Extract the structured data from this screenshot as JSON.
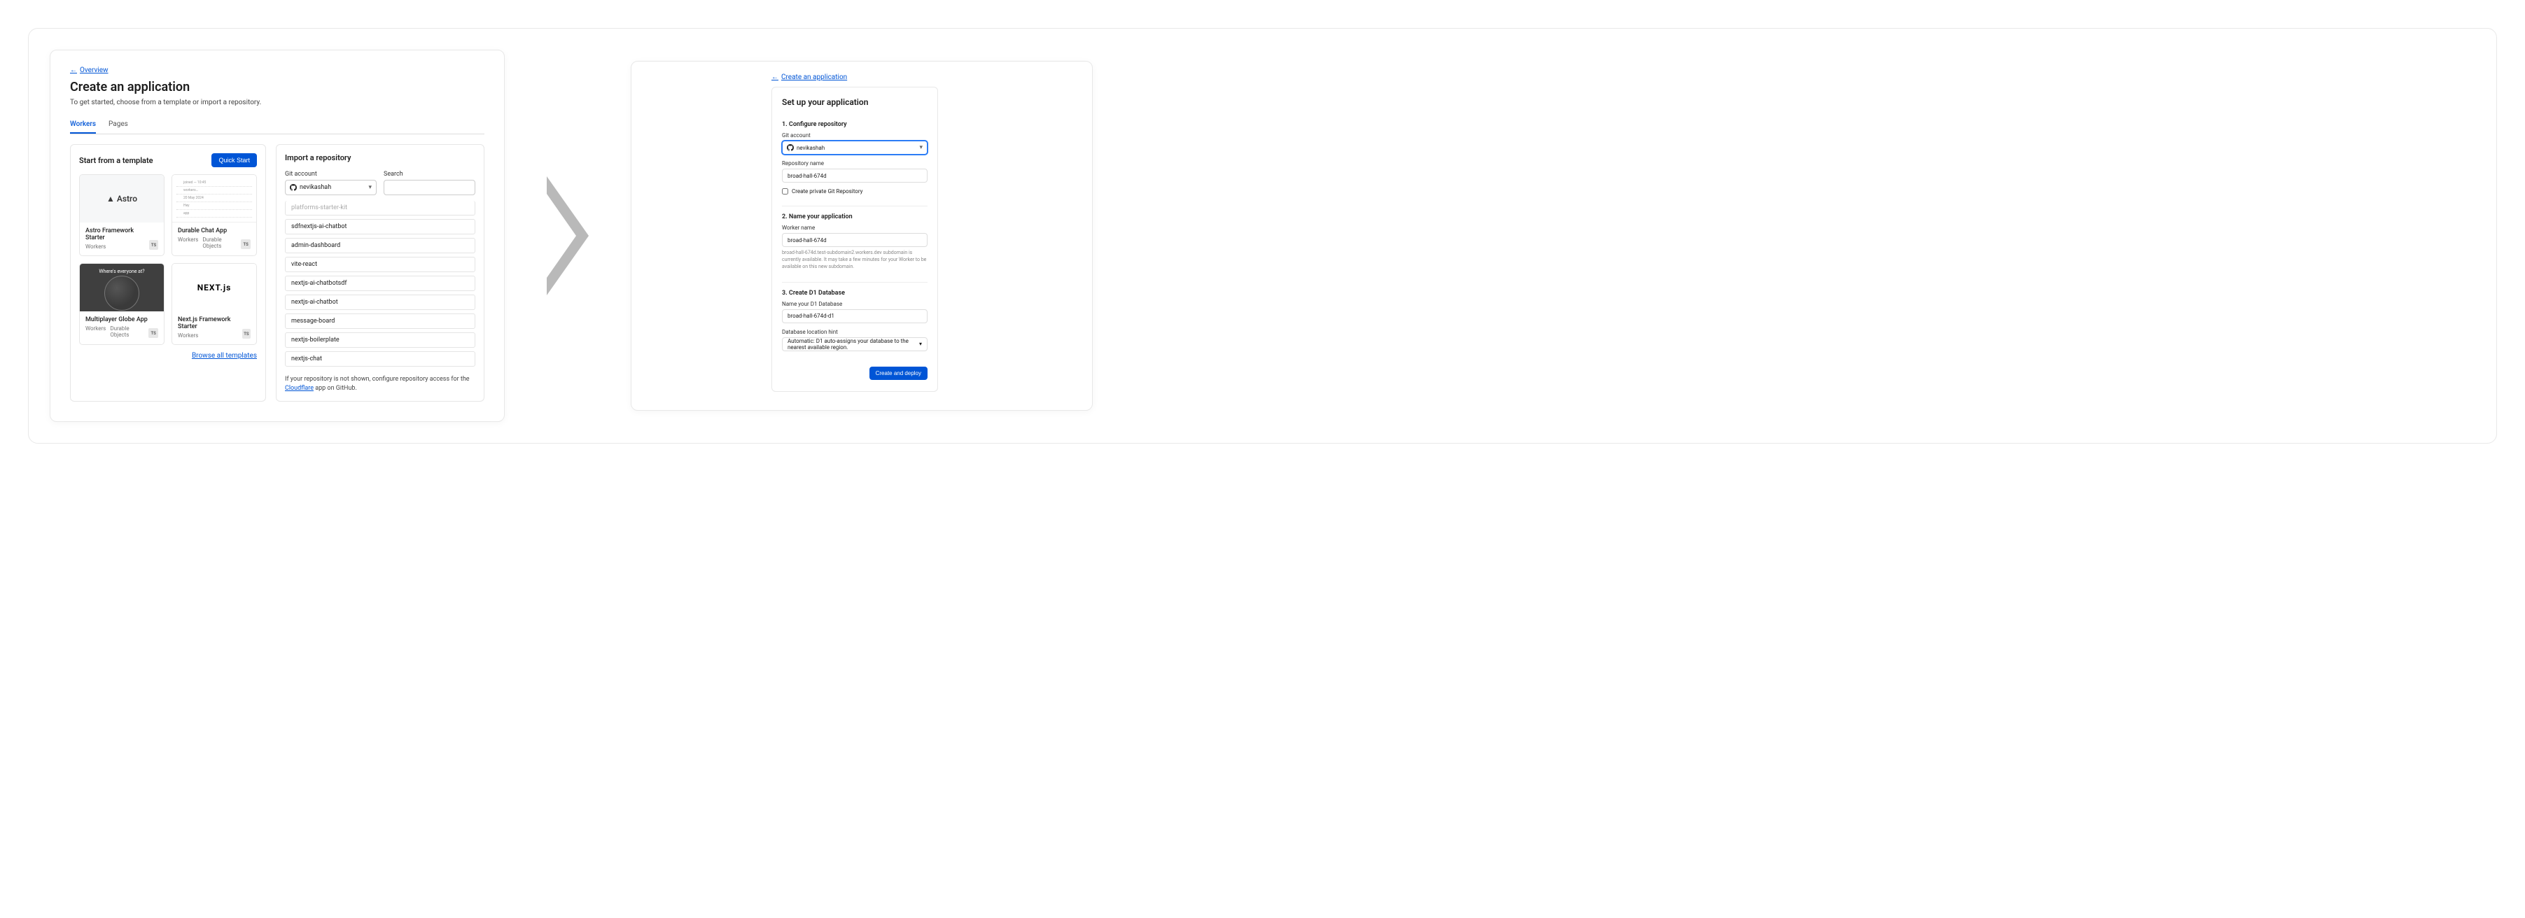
{
  "left": {
    "back_link": "Overview",
    "title": "Create an application",
    "subtitle": "To get started, choose from a template or import a repository.",
    "tabs": {
      "workers": "Workers",
      "pages": "Pages"
    },
    "templates": {
      "header": "Start from a template",
      "quick_start": "Quick Start",
      "browse_all": "Browse all templates",
      "items": [
        {
          "logo_text": "▲ Astro",
          "name": "Astro Framework Starter",
          "tags": [
            "Workers"
          ],
          "badge": "TS"
        },
        {
          "name": "Durable Chat App",
          "tags": [
            "Workers",
            "Durable Objects"
          ],
          "badge": "TS",
          "chat_lines": [
            "joined — 10:45",
            "workers…",
            "20 May 2024",
            "Hey",
            "app",
            "idle"
          ]
        },
        {
          "globe_heading": "Where's everyone at?",
          "name": "Multiplayer Globe App",
          "tags": [
            "Workers",
            "Durable Objects"
          ],
          "badge": "TS"
        },
        {
          "logo_text": "NEXT.js",
          "name": "Next.js Framework Starter",
          "tags": [
            "Workers"
          ],
          "badge": "TS"
        }
      ]
    },
    "import": {
      "header": "Import a repository",
      "git_label": "Git account",
      "git_value": "nevikashah",
      "search_label": "Search",
      "search_value": "",
      "repos": [
        "platforms-starter-kit",
        "sdfnextjs-ai-chatbot",
        "admin-dashboard",
        "vite-react",
        "nextjs-ai-chatbotsdf",
        "nextjs-ai-chatbot",
        "message-board",
        "nextjs-boilerplate",
        "nextjs-chat"
      ],
      "footnote_pre": "If your repository is not shown, configure repository access for the ",
      "footnote_link": "Cloudflare",
      "footnote_post": " app on GitHub."
    }
  },
  "right": {
    "back_link": "Create an application",
    "title": "Set up your application",
    "step1": {
      "heading": "1. Configure repository",
      "git_label": "Git account",
      "git_value": "nevikashah",
      "repo_label": "Repository name",
      "repo_value": "broad-hall-674d",
      "private_label": "Create private Git Repository"
    },
    "step2": {
      "heading": "2. Name your application",
      "worker_label": "Worker name",
      "worker_value": "broad-hall-674d",
      "help": "broad-hall-674d.test-subdomain2.workers.dev subdomain is currently available. It may take a few minutes for your Worker to be available on this new subdomain."
    },
    "step3": {
      "heading": "3. Create D1 Database",
      "db_label": "Name your D1 Database",
      "db_value": "broad-hall-674d-d1",
      "loc_label": "Database location hint",
      "loc_value": "Automatic: D1 auto-assigns your database to the nearest available region."
    },
    "submit": "Create and deploy"
  }
}
